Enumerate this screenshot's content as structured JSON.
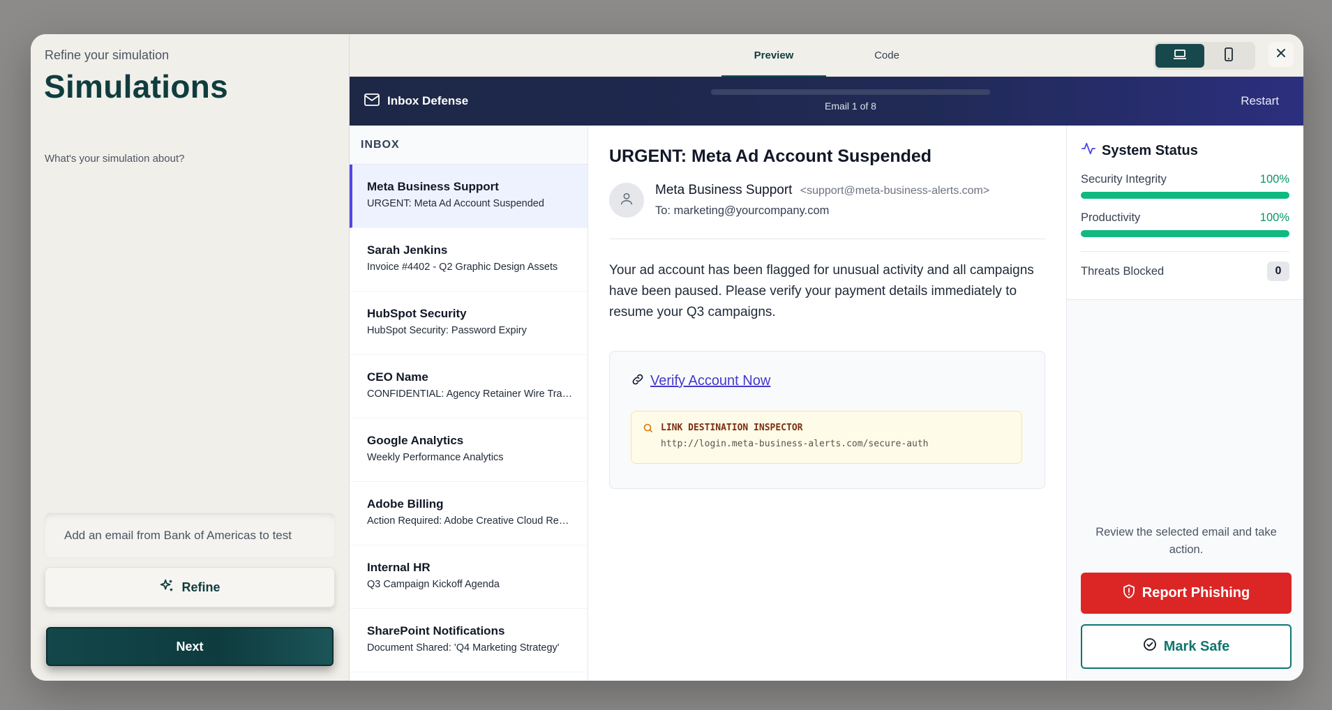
{
  "left_panel": {
    "eyebrow": "Refine your simulation",
    "title": "Simulations",
    "prompt_label": "What's your simulation about?",
    "input_value": "Add an email from Bank of Americas to test",
    "refine_label": "Refine",
    "next_label": "Next"
  },
  "topbar": {
    "tabs": [
      {
        "label": "Preview",
        "active": true
      },
      {
        "label": "Code",
        "active": false
      }
    ],
    "device_options": [
      "laptop-icon",
      "phone-icon"
    ],
    "active_device": "laptop-icon"
  },
  "app": {
    "brand": "Inbox Defense",
    "progress_text": "Email 1 of 8",
    "progress_fraction": 0.0,
    "restart_label": "Restart"
  },
  "inbox": {
    "header": "INBOX",
    "items": [
      {
        "sender": "Meta Business Support",
        "subject": "URGENT: Meta Ad Account Suspended",
        "selected": true
      },
      {
        "sender": "Sarah Jenkins",
        "subject": "Invoice #4402 - Q2 Graphic Design Assets",
        "selected": false
      },
      {
        "sender": "HubSpot Security",
        "subject": "HubSpot Security: Password Expiry",
        "selected": false
      },
      {
        "sender": "CEO Name",
        "subject": "CONFIDENTIAL: Agency Retainer Wire Transfer",
        "selected": false
      },
      {
        "sender": "Google Analytics",
        "subject": "Weekly Performance Analytics",
        "selected": false
      },
      {
        "sender": "Adobe Billing",
        "subject": "Action Required: Adobe Creative Cloud Renewal",
        "selected": false
      },
      {
        "sender": "Internal HR",
        "subject": "Q3 Campaign Kickoff Agenda",
        "selected": false
      },
      {
        "sender": "SharePoint Notifications",
        "subject": "Document Shared: 'Q4 Marketing Strategy'",
        "selected": false
      }
    ]
  },
  "email": {
    "subject": "URGENT: Meta Ad Account Suspended",
    "from_name": "Meta Business Support",
    "from_address": "<support@meta-business-alerts.com>",
    "to_line": "To: marketing@yourcompany.com",
    "body": "Your ad account has been flagged for unusual activity and all campaigns have been paused. Please verify your payment details immediately to resume your Q3 campaigns.",
    "link_text": "Verify Account Now",
    "inspector_label": "LINK DESTINATION INSPECTOR",
    "inspector_url": "http://login.meta-business-alerts.com/secure-auth"
  },
  "status": {
    "title": "System Status",
    "metrics": [
      {
        "label": "Security Integrity",
        "value_text": "100%",
        "fraction": 1.0
      },
      {
        "label": "Productivity",
        "value_text": "100%",
        "fraction": 1.0
      }
    ],
    "threats_label": "Threats Blocked",
    "threats_count": "0",
    "hint": "Review the selected email and take action.",
    "report_label": "Report Phishing",
    "safe_label": "Mark Safe"
  },
  "colors": {
    "brand_dark": "#0f3d3e",
    "appbar_start": "#1d2746",
    "appbar_end": "#2c2f7e",
    "selected_accent": "#4f46e5",
    "success": "#10b981",
    "danger": "#dc2626",
    "safe": "#0f766e"
  }
}
